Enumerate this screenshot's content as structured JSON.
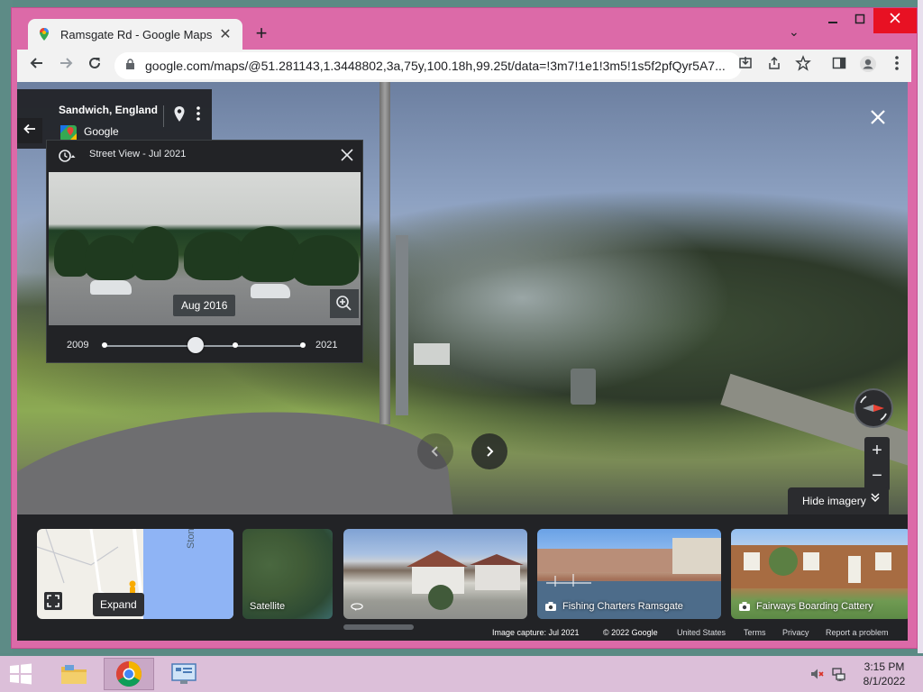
{
  "browser": {
    "tab_title": "Ramsgate Rd - Google Maps",
    "url": "google.com/maps/@51.281143,1.3448802,3a,75y,100.18h,99.25t/data=!3m7!1e1!3m5!1s5f2pfQyr5A7...",
    "new_tab_label": "+",
    "tab_search_label": "⌄"
  },
  "place": {
    "name": "Sandwich, England",
    "provider": "Google"
  },
  "time_machine": {
    "header": "Street View - Jul 2021",
    "selected_date": "Aug 2016",
    "start_year": "2009",
    "end_year": "2021",
    "selected_position_fraction": 0.46,
    "dot_fractions": [
      0.0,
      0.66,
      1.0
    ]
  },
  "controls": {
    "hide_imagery_label": "Hide imagery"
  },
  "strip": {
    "map_lane_label": "Stonar La",
    "expand_tooltip": "Expand",
    "satellite_label": "Satellite",
    "fishing_label": "Fishing Charters Ramsgate",
    "cattery_label": "Fairways Boarding Cattery"
  },
  "footer": {
    "image_capture": "Image capture: Jul 2021",
    "copyright": "© 2022 Google",
    "country": "United States",
    "terms": "Terms",
    "privacy": "Privacy",
    "report": "Report a problem"
  },
  "taskbar": {
    "time": "3:15 PM",
    "date": "8/1/2022"
  },
  "colors": {
    "window_frame": "#dc6aa8",
    "panel_dark": "#222326",
    "close_button": "#e81123"
  }
}
